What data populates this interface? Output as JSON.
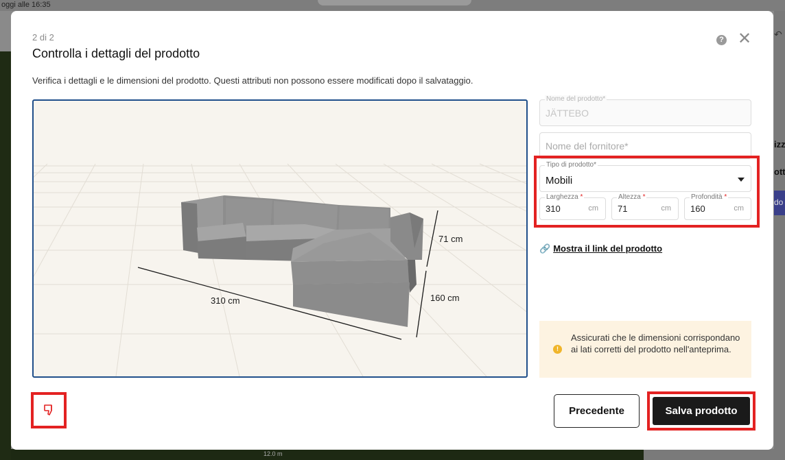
{
  "background": {
    "saved_status": "oggi alle 16:35",
    "right_text_1": "izz",
    "right_text_2": "otti",
    "right_button": "do",
    "scale_label": "12.0 m"
  },
  "modal": {
    "step": "2 di 2",
    "title": "Controlla i dettagli del prodotto",
    "subtitle": "Verifica i dettagli e le dimensioni del prodotto. Questi attributi non possono essere modificati dopo il salvataggio.",
    "help_icon": "question-circle-icon",
    "close_icon": "close-icon"
  },
  "preview": {
    "label_width": "310 cm",
    "label_height": "71 cm",
    "label_depth": "160 cm"
  },
  "form": {
    "product_name_label": "Nome del prodotto*",
    "product_name_value": "JÄTTEBO",
    "supplier_placeholder": "Nome del fornitore*",
    "type_label": "Tipo di prodotto*",
    "type_value": "Mobili",
    "width_label": "Larghezza",
    "width_value": "310",
    "height_label": "Altezza",
    "height_value": "71",
    "depth_label": "Profondità",
    "depth_value": "160",
    "required_mark": "*",
    "unit": "cm",
    "link_text": "Mostra il link del prodotto"
  },
  "notice": {
    "text": "Assicurati che le dimensioni corrispondano ai lati corretti del prodotto nell'anteprima."
  },
  "footer": {
    "prev_label": "Precedente",
    "save_label": "Salva prodotto"
  },
  "colors": {
    "highlight": "#e32222",
    "preview_border": "#1f4e8a",
    "notice_bg": "#fdf3e1",
    "save_bg": "#1a1a1a"
  }
}
